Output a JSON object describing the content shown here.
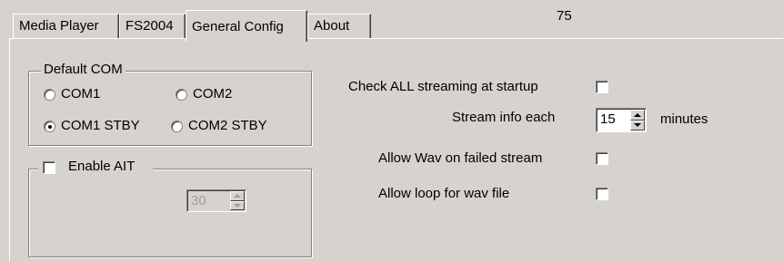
{
  "tabs": [
    "Media Player",
    "FS2004",
    "General Config",
    "About"
  ],
  "counter": "75",
  "default_com": {
    "legend": "Default COM",
    "options": [
      "COM1",
      "COM2",
      "COM1 STBY",
      "COM2 STBY"
    ],
    "selected": "COM1 STBY"
  },
  "ait": {
    "label": "Enable AIT",
    "checked": false,
    "spinner_value": "30",
    "spinner_enabled": false
  },
  "settings": {
    "check_all_label": "Check ALL streaming at startup",
    "check_all_checked": false,
    "stream_info_label": "Stream info each",
    "stream_info_value": "15",
    "stream_info_unit": "minutes",
    "allow_wav_label": "Allow Wav on failed stream",
    "allow_wav_checked": false,
    "allow_loop_label": "Allow loop for wav file",
    "allow_loop_checked": false
  },
  "colors": {
    "face": "#d6d3ce",
    "disabled_text": "#a0a0a0"
  }
}
